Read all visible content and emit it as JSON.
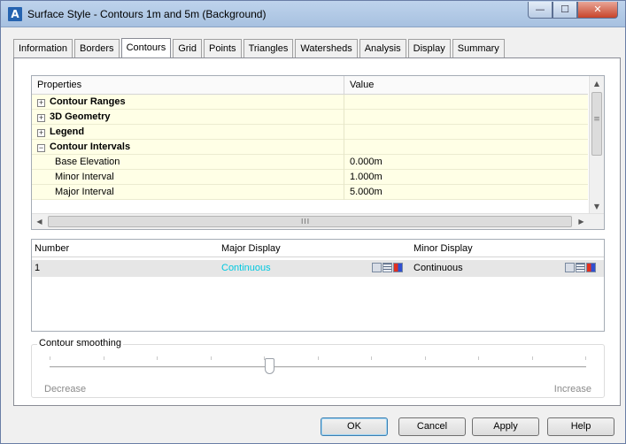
{
  "window": {
    "title": "Surface Style - Contours 1m and 5m (Background)",
    "app_icon": "A",
    "controls": {
      "minimize": "—",
      "maximize": "☐",
      "close": "✕"
    }
  },
  "tabs": [
    {
      "label": "Information",
      "active": false
    },
    {
      "label": "Borders",
      "active": false
    },
    {
      "label": "Contours",
      "active": true
    },
    {
      "label": "Grid",
      "active": false
    },
    {
      "label": "Points",
      "active": false
    },
    {
      "label": "Triangles",
      "active": false
    },
    {
      "label": "Watersheds",
      "active": false
    },
    {
      "label": "Analysis",
      "active": false
    },
    {
      "label": "Display",
      "active": false
    },
    {
      "label": "Summary",
      "active": false
    }
  ],
  "properties": {
    "header": {
      "name": "Properties",
      "value": "Value"
    },
    "rows": [
      {
        "name": "Contour Ranges",
        "value": "",
        "group": true,
        "expander": "⊞"
      },
      {
        "name": "3D Geometry",
        "value": "",
        "group": true,
        "expander": "⊞"
      },
      {
        "name": "Legend",
        "value": "",
        "group": true,
        "expander": "⊞"
      },
      {
        "name": "Contour Intervals",
        "value": "",
        "group": true,
        "expander": "⊟"
      },
      {
        "name": "Base Elevation",
        "value": "0.000m",
        "group": false
      },
      {
        "name": "Minor Interval",
        "value": "1.000m",
        "group": false
      },
      {
        "name": "Major Interval",
        "value": "5.000m",
        "group": false
      }
    ],
    "hscroll_grip": "III"
  },
  "display_grid": {
    "columns": {
      "number": "Number",
      "major": "Major Display",
      "minor": "Minor Display"
    },
    "rows": [
      {
        "number": "1",
        "major": "Continuous",
        "minor": "Continuous"
      }
    ],
    "major_color": "#00c8e0"
  },
  "smoothing": {
    "label": "Contour smoothing",
    "min_label": "Decrease",
    "max_label": "Increase",
    "value_fraction": 0.41
  },
  "buttons": {
    "ok": "OK",
    "cancel": "Cancel",
    "apply": "Apply",
    "help": "Help"
  }
}
